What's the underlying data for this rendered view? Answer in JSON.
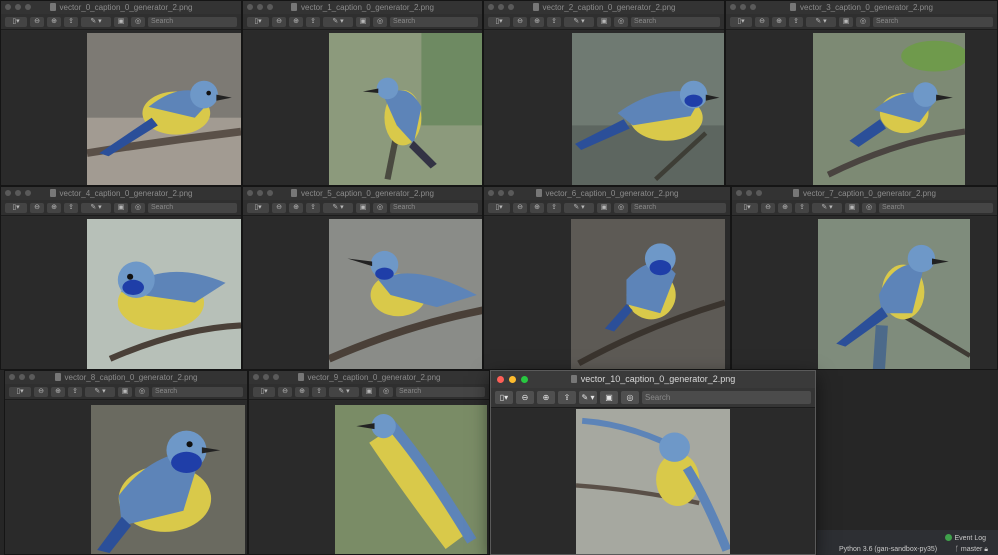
{
  "toolbar": {
    "search_placeholder": "Search"
  },
  "windows": [
    {
      "title": "vector_0_caption_0_generator_2.png"
    },
    {
      "title": "vector_1_caption_0_generator_2.png"
    },
    {
      "title": "vector_2_caption_0_generator_2.png"
    },
    {
      "title": "vector_3_caption_0_generator_2.png"
    },
    {
      "title": "vector_4_caption_0_generator_2.png"
    },
    {
      "title": "vector_5_caption_0_generator_2.png"
    },
    {
      "title": "vector_6_caption_0_generator_2.png"
    },
    {
      "title": "vector_7_caption_0_generator_2.png"
    },
    {
      "title": "vector_8_caption_0_generator_2.png"
    },
    {
      "title": "vector_9_caption_0_generator_2.png"
    },
    {
      "title": "vector_10_caption_0_generator_2.png"
    }
  ],
  "statusbar": {
    "event_log": "Event Log",
    "interpreter": "Python 3.6 (gan-sandbox-py35)",
    "branch": "master"
  },
  "colors": {
    "bird_blue": "#5d84b8",
    "bird_yellow": "#d9c94a",
    "window_bg": "#2b2b2b",
    "event_log_green": "#3fa14b"
  }
}
